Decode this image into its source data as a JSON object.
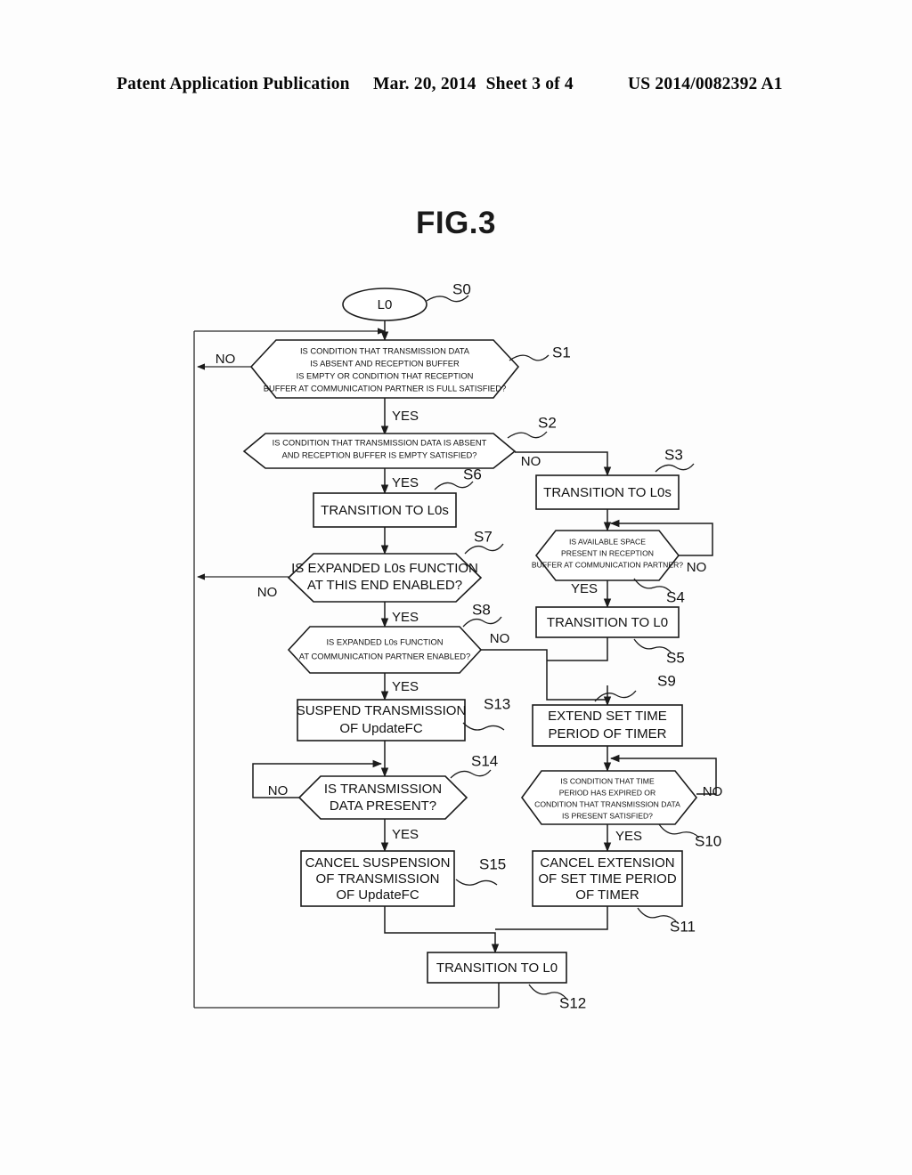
{
  "header": {
    "left": "Patent Application Publication",
    "date": "Mar. 20, 2014",
    "sheet": "Sheet 3 of 4",
    "pub_number": "US 2014/0082392 A1"
  },
  "figure": {
    "title": "FIG.3"
  },
  "labels": {
    "yes": "YES",
    "no": "NO"
  },
  "flowchart": {
    "nodes": [
      {
        "id": "S0",
        "step": "S0",
        "shape": "terminator",
        "lines": [
          "L0"
        ]
      },
      {
        "id": "S1",
        "step": "S1",
        "shape": "decision",
        "lines": [
          "IS CONDITION THAT TRANSMISSION DATA",
          "IS ABSENT AND RECEPTION BUFFER",
          "IS EMPTY OR CONDITION THAT RECEPTION",
          "BUFFER AT COMMUNICATION PARTNER IS FULL SATISFIED?"
        ]
      },
      {
        "id": "S2",
        "step": "S2",
        "shape": "decision",
        "lines": [
          "IS CONDITION THAT TRANSMISSION DATA IS ABSENT",
          "AND RECEPTION BUFFER IS EMPTY SATISFIED?"
        ]
      },
      {
        "id": "S3",
        "step": "S3",
        "shape": "process",
        "lines": [
          "TRANSITION TO L0s"
        ]
      },
      {
        "id": "S4",
        "step": "S4",
        "shape": "decision",
        "lines": [
          "IS AVAILABLE SPACE",
          "PRESENT IN RECEPTION",
          "BUFFER AT COMMUNICATION PARTNER?"
        ]
      },
      {
        "id": "S5",
        "step": "S5",
        "shape": "process",
        "lines": [
          "TRANSITION TO L0"
        ]
      },
      {
        "id": "S6",
        "step": "S6",
        "shape": "process",
        "lines": [
          "TRANSITION TO L0s"
        ]
      },
      {
        "id": "S7",
        "step": "S7",
        "shape": "decision",
        "lines": [
          "IS EXPANDED L0s FUNCTION",
          "AT THIS END ENABLED?"
        ]
      },
      {
        "id": "S8",
        "step": "S8",
        "shape": "decision",
        "lines": [
          "IS EXPANDED L0s FUNCTION",
          "AT COMMUNICATION PARTNER ENABLED?"
        ]
      },
      {
        "id": "S9",
        "step": "S9",
        "shape": "process",
        "lines": [
          "EXTEND SET TIME",
          "PERIOD OF TIMER"
        ]
      },
      {
        "id": "S10",
        "step": "S10",
        "shape": "decision",
        "lines": [
          "IS CONDITION THAT TIME",
          "PERIOD HAS EXPIRED OR",
          "CONDITION THAT TRANSMISSION DATA",
          "IS PRESENT SATISFIED?"
        ]
      },
      {
        "id": "S11",
        "step": "S11",
        "shape": "process",
        "lines": [
          "CANCEL EXTENSION",
          "OF SET TIME PERIOD",
          "OF TIMER"
        ]
      },
      {
        "id": "S12",
        "step": "S12",
        "shape": "process",
        "lines": [
          "TRANSITION TO L0"
        ]
      },
      {
        "id": "S13",
        "step": "S13",
        "shape": "process",
        "lines": [
          "SUSPEND TRANSMISSION",
          "OF UpdateFC"
        ]
      },
      {
        "id": "S14",
        "step": "S14",
        "shape": "decision",
        "lines": [
          "IS TRANSMISSION",
          "DATA PRESENT?"
        ]
      },
      {
        "id": "S15",
        "step": "S15",
        "shape": "process",
        "lines": [
          "CANCEL SUSPENSION",
          "OF TRANSMISSION",
          "OF UpdateFC"
        ]
      }
    ],
    "branches": [
      {
        "from": "S1",
        "label": "NO",
        "to": "return-left"
      },
      {
        "from": "S1",
        "label": "YES",
        "to": "S2"
      },
      {
        "from": "S2",
        "label": "YES",
        "to": "S6"
      },
      {
        "from": "S2",
        "label": "NO",
        "to": "S3"
      },
      {
        "from": "S4",
        "label": "YES",
        "to": "S5"
      },
      {
        "from": "S4",
        "label": "NO",
        "to": "S4"
      },
      {
        "from": "S7",
        "label": "NO",
        "to": "return-left"
      },
      {
        "from": "S7",
        "label": "YES",
        "to": "S8"
      },
      {
        "from": "S8",
        "label": "YES",
        "to": "S13"
      },
      {
        "from": "S8",
        "label": "NO",
        "to": "S9"
      },
      {
        "from": "S10",
        "label": "YES",
        "to": "S11"
      },
      {
        "from": "S10",
        "label": "NO",
        "to": "S10"
      },
      {
        "from": "S14",
        "label": "NO",
        "to": "S14"
      },
      {
        "from": "S14",
        "label": "YES",
        "to": "S15"
      }
    ]
  },
  "colors": {
    "ink": "#1b1b1b",
    "paper": "#fdfdfd"
  }
}
